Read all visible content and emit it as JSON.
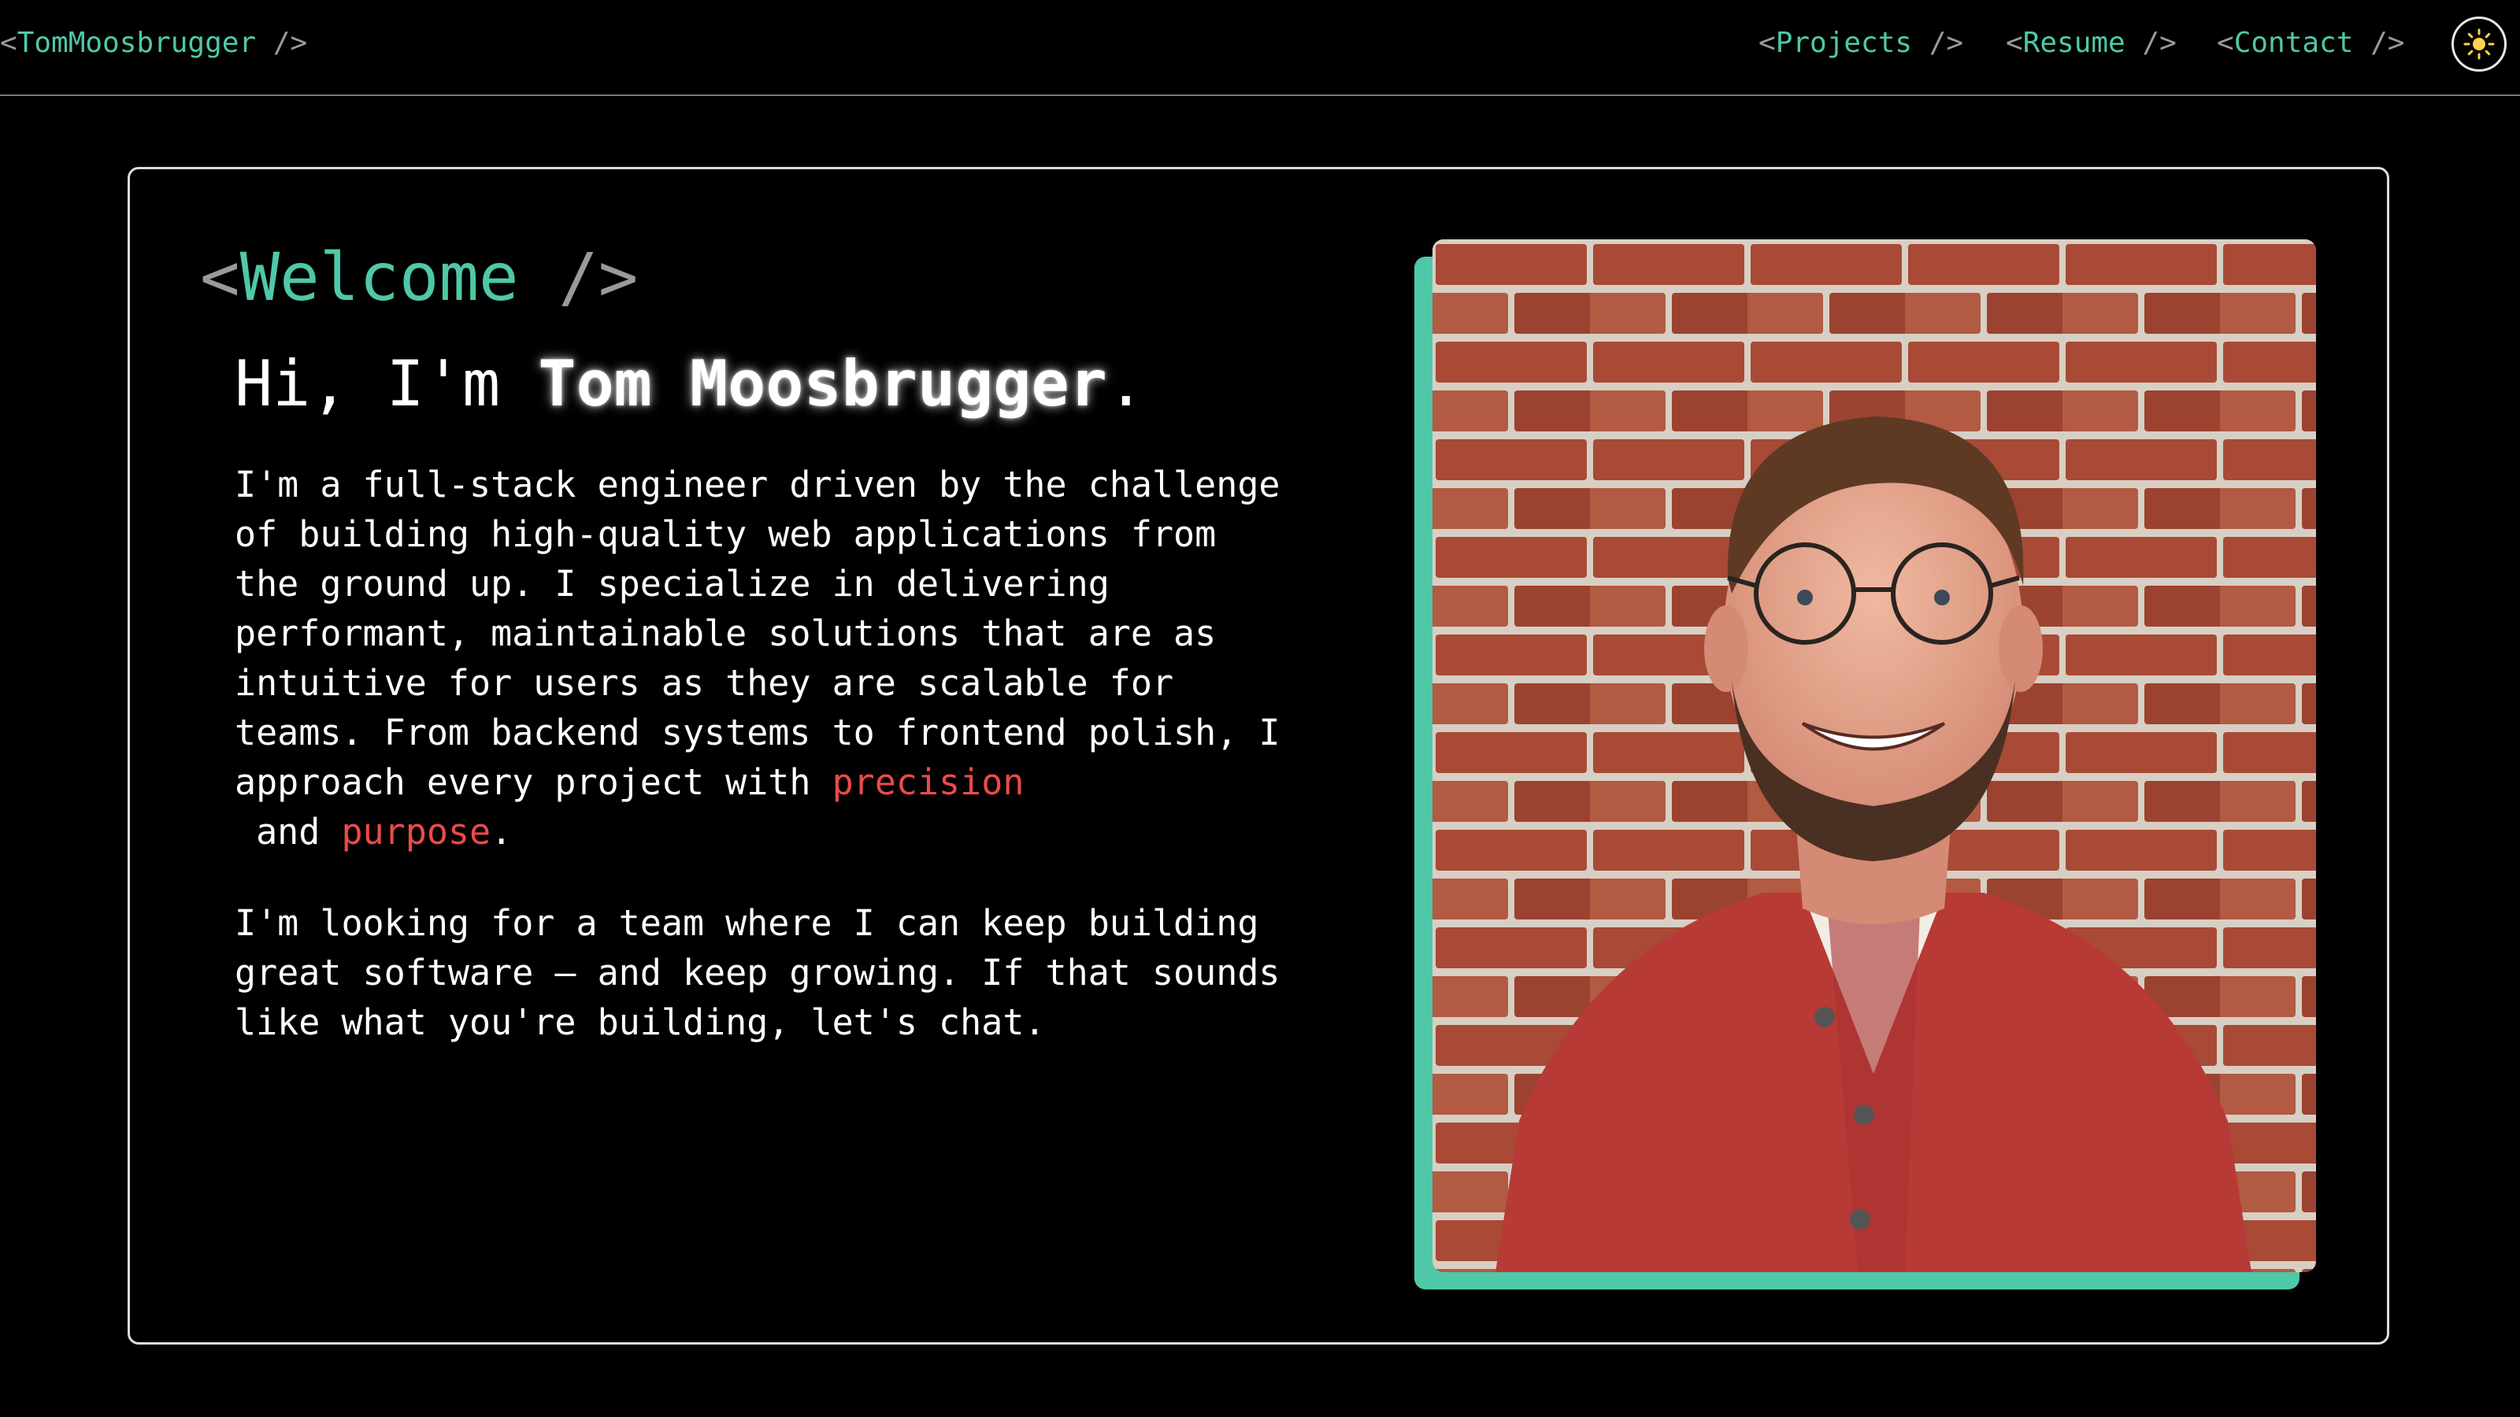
{
  "header": {
    "brand": {
      "open": "<",
      "name": "TomMoosbrugger",
      "close": " />"
    },
    "nav": [
      {
        "open": "<",
        "label": "Projects",
        "close": " />"
      },
      {
        "open": "<",
        "label": "Resume",
        "close": " />"
      },
      {
        "open": "<",
        "label": "Contact",
        "close": " />"
      }
    ],
    "theme_toggle_icon": "sun-icon"
  },
  "hero": {
    "welcome": {
      "open": "<",
      "label": "Welcome",
      "close": " />"
    },
    "greeting": {
      "prefix": "Hi, I'm ",
      "name": "Tom Moosbrugger",
      "suffix": "."
    },
    "para1": {
      "text": "I'm a full-stack engineer driven by the challenge of building high-quality web applications from the ground up. I specialize in delivering performant, maintainable solutions that are as intuitive for users as they are scalable for teams. From backend systems to frontend polish, I approach every project with ",
      "highlight1": "precision",
      "joiner": " and ",
      "highlight2": "purpose",
      "end": "."
    },
    "para2": "I'm looking for a team where I can keep building great software — and keep growing. If that sounds like what you're building, let's chat.",
    "photo_icon": "portrait-photo"
  },
  "colors": {
    "accent": "#4fc8a8",
    "highlight": "#ec4a4a",
    "background": "#000000",
    "muted": "#9a9a9a"
  }
}
